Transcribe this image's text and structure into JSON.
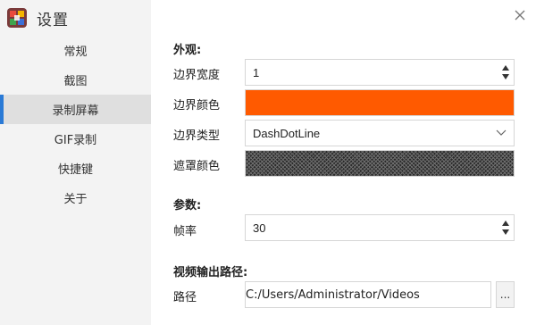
{
  "app": {
    "title": "设置"
  },
  "sidebar": {
    "items": [
      {
        "label": "常规"
      },
      {
        "label": "截图"
      },
      {
        "label": "录制屏幕"
      },
      {
        "label": "GIF录制"
      },
      {
        "label": "快捷键"
      },
      {
        "label": "关于"
      }
    ],
    "active_index": 2
  },
  "appearance": {
    "section_title": "外观:",
    "border_width_label": "边界宽度",
    "border_width_value": "1",
    "border_color_label": "边界颜色",
    "border_color_value": "#ff5a00",
    "border_type_label": "边界类型",
    "border_type_value": "DashDotLine",
    "mask_color_label": "遮罩颜色"
  },
  "params": {
    "section_title": "参数:",
    "frame_rate_label": "帧率",
    "frame_rate_value": "30"
  },
  "output": {
    "section_title": "视频输出路径:",
    "path_label": "路径",
    "path_value": "C:/Users/Administrator/Videos",
    "browse_label": "..."
  },
  "colors": {
    "accent": "#2a7ad6",
    "border_swatch": "#ff5a00",
    "mask_swatch": "#6e6e6e"
  },
  "icons": {
    "app_logo": "app-logo-icon",
    "close": "close-icon",
    "spin_up": "spin-up-icon",
    "spin_down": "spin-down-icon",
    "dropdown": "chevron-down-icon"
  }
}
